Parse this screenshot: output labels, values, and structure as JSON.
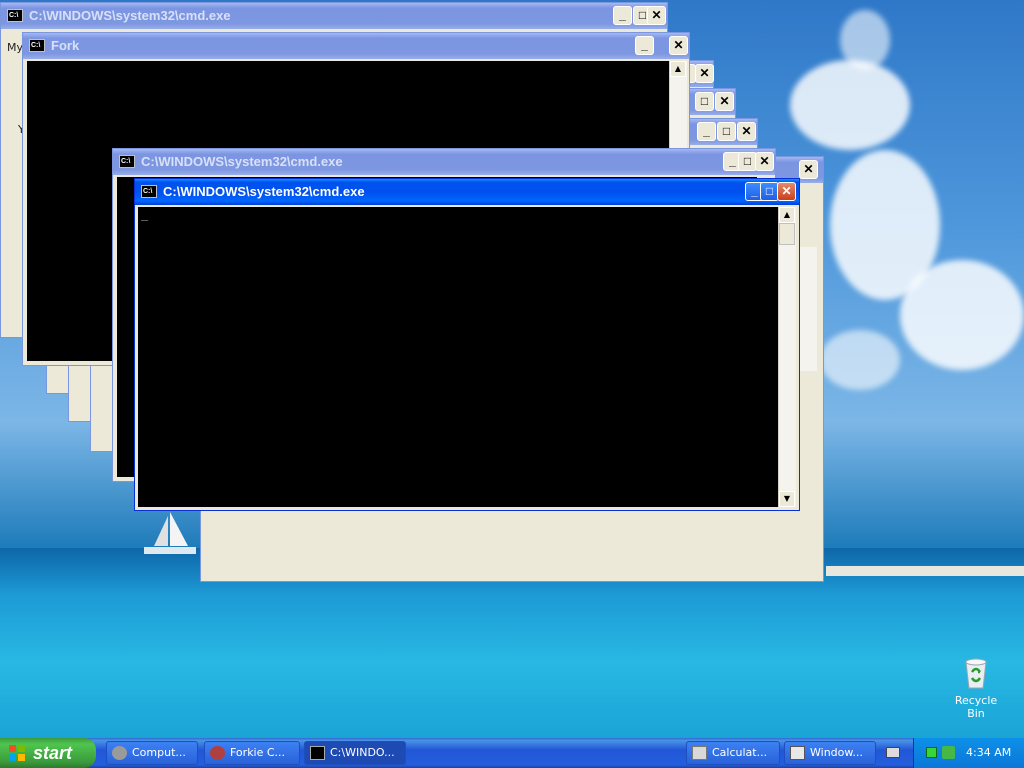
{
  "colors": {
    "titlebar_active": "#0053ee",
    "titlebar_inactive": "#7e97e1",
    "console_bg": "#000000",
    "taskbar": "#245edc",
    "start_green": "#3b9b3b",
    "tray_blue": "#0b77d8"
  },
  "icons": {
    "cmd": "command-prompt-icon",
    "minimize": "minimize-icon",
    "maximize": "maximize-icon",
    "close": "close-icon",
    "start": "windows-flag-icon",
    "recycle": "recycle-bin-icon"
  },
  "windows": {
    "back_cmd_title": "C:\\WINDOWS\\system32\\cmd.exe",
    "fork_title": "Fork",
    "mid_cmd_title": "C:\\WINDOWS\\system32\\cmd.exe",
    "front_cmd_title": "C:\\WINDOWS\\system32\\cmd.exe",
    "ticon_text": "C:\\",
    "minimize_glyph": "_",
    "maximize_glyph": "□",
    "close_glyph": "✕",
    "cursor": "_",
    "partial_left_text": "My",
    "partial_left_text2": "Y",
    "scroll_up": "▲",
    "scroll_down": "▼"
  },
  "desktop": {
    "recycle_bin_label": "Recycle Bin"
  },
  "taskbar": {
    "start_label": "start",
    "items": [
      {
        "label": "Comput..."
      },
      {
        "label": "Forkie C..."
      },
      {
        "label": "C:\\WINDO..."
      },
      {
        "label": "Calculat..."
      },
      {
        "label": "Window..."
      }
    ],
    "clock": "4:34 AM"
  }
}
